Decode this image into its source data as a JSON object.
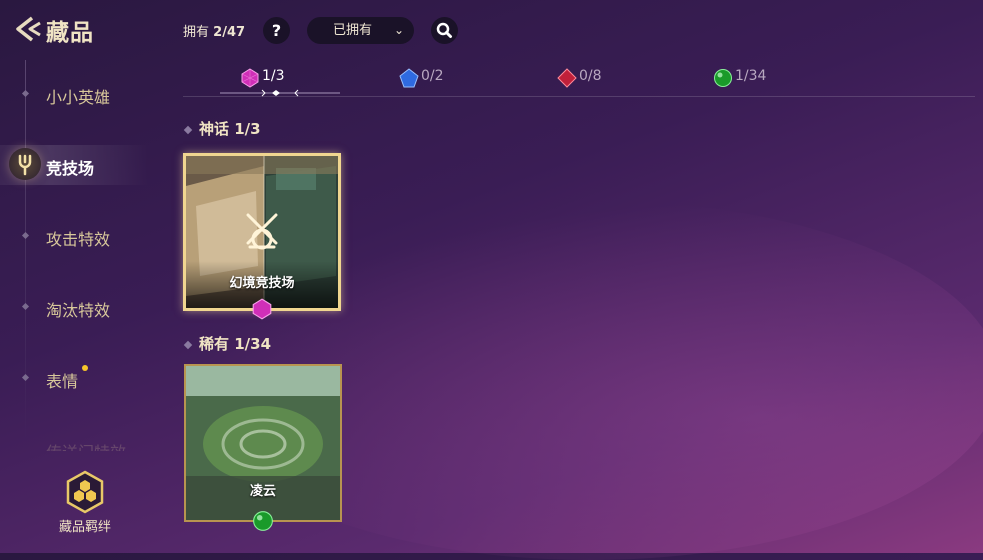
{
  "header": {
    "title": "藏品",
    "owned_label": "拥有",
    "owned_count": "2/47",
    "help_label": "?",
    "filter": {
      "selected": "已拥有"
    }
  },
  "sidebar": {
    "items": [
      {
        "label": "小小英雄"
      },
      {
        "label": "竞技场"
      },
      {
        "label": "攻击特效"
      },
      {
        "label": "淘汰特效"
      },
      {
        "label": "表情"
      },
      {
        "label": "传送门特效"
      }
    ],
    "bond_label": "藏品羁绊"
  },
  "rarity_tabs": [
    {
      "gem": "mythic-gem-icon",
      "count": "1/3",
      "color": "#d02fb8"
    },
    {
      "gem": "epic-gem-icon",
      "count": "0/2",
      "color": "#2f6ae0"
    },
    {
      "gem": "legendary-gem-icon",
      "count": "0/8",
      "color": "#c0203a"
    },
    {
      "gem": "rare-gem-icon",
      "count": "1/34",
      "color": "#1a9a2a"
    }
  ],
  "sections": [
    {
      "title": "神话 1/3",
      "cards": [
        {
          "name": "幻境竞技场",
          "gem": "mythic-gem-icon"
        }
      ]
    },
    {
      "title": "稀有 1/34",
      "cards": [
        {
          "name": "凌云",
          "gem": "rare-gem-icon"
        }
      ]
    }
  ]
}
